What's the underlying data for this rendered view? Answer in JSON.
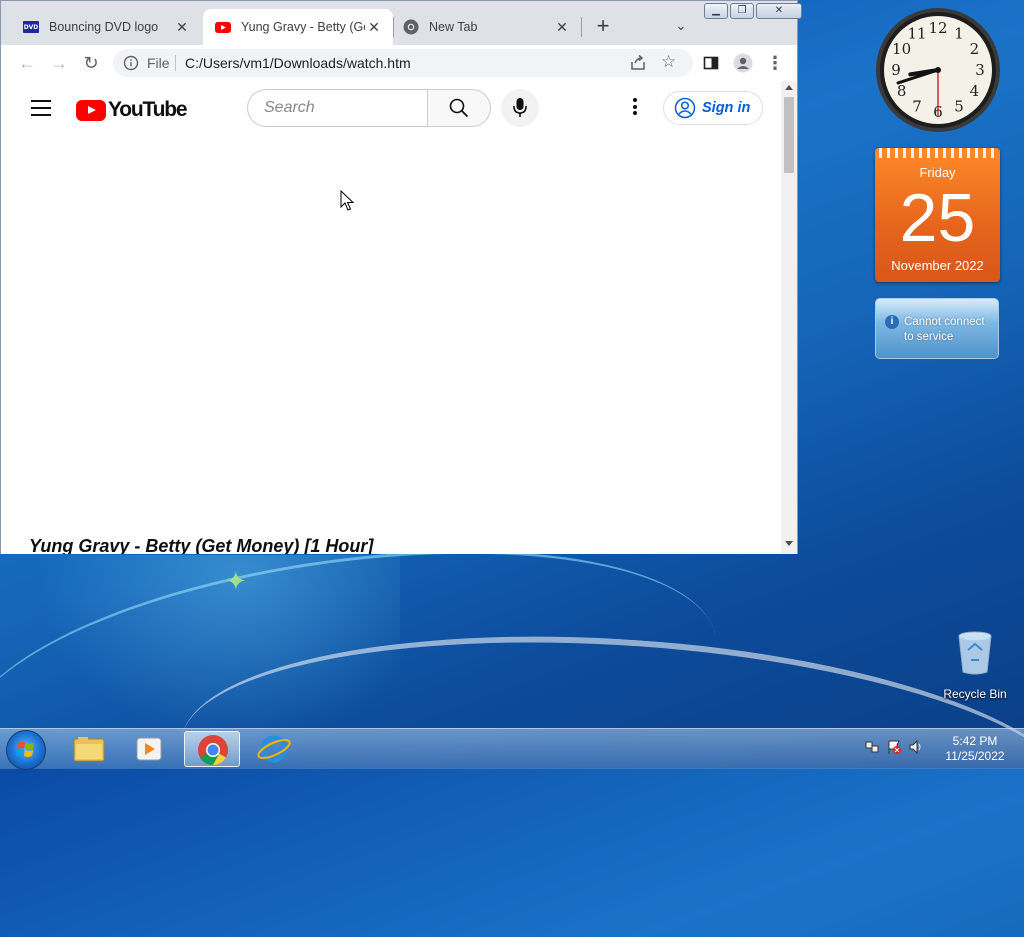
{
  "browser": {
    "tabs": [
      {
        "title": "Bouncing DVD logo",
        "favicon": "dvd-icon"
      },
      {
        "title": "Yung Gravy - Betty (Get",
        "favicon": "youtube-icon",
        "active": true
      },
      {
        "title": "New Tab",
        "favicon": "chrome-icon"
      }
    ],
    "address": {
      "scheme_label": "File",
      "url": "C:/Users/vm1/Downloads/watch.htm"
    }
  },
  "youtube": {
    "logo_text": "YouTube",
    "search_placeholder": "Search",
    "sign_in_label": "Sign in",
    "video_title": "Yung Gravy - Betty (Get Money) [1 Hour]"
  },
  "gadgets": {
    "clock": {
      "hour": 8,
      "minute": 42,
      "second": 30
    },
    "calendar": {
      "day_name": "Friday",
      "date": "25",
      "month_year": "November 2022"
    },
    "weather": {
      "message": "Cannot connect to service"
    }
  },
  "desktop": {
    "recycle_bin_label": "Recycle Bin"
  },
  "taskbar": {
    "apps": [
      "explorer-icon",
      "media-player-icon",
      "chrome-icon",
      "internet-explorer-icon"
    ],
    "time": "5:42 PM",
    "date": "11/25/2022"
  },
  "colors": {
    "youtube_red": "#ff0000",
    "link_blue": "#065fd4",
    "calendar_orange": "#e5641c"
  }
}
